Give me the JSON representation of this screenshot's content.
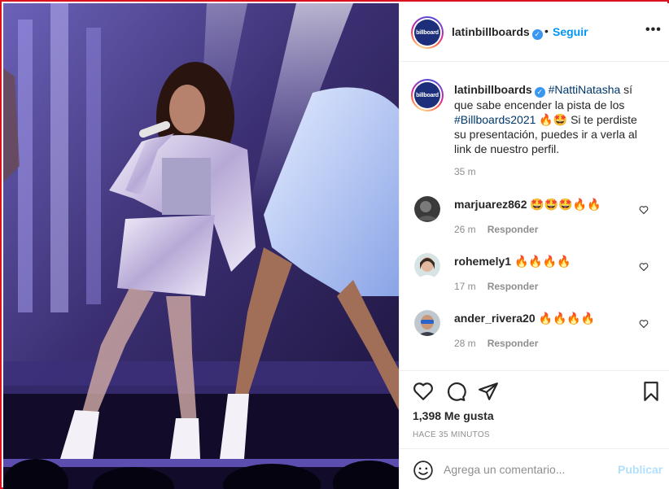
{
  "header": {
    "username": "latinbillboards",
    "separator": "•",
    "follow_label": "Seguir",
    "more_label": "•••",
    "logo_text": "billboard"
  },
  "caption": {
    "username": "latinbillboards",
    "hashtag1": "#NattiNatasha",
    "text1": " sí que sabe encender la pista de los ",
    "hashtag2": "#Billboards2021",
    "emojis": " 🔥🤩 ",
    "text2": "Si te perdiste su presentación, puedes ir a verla al link de nuestro perfil.",
    "time": "35 m"
  },
  "comments": [
    {
      "username": "marjuarez862",
      "text": "🤩🤩🤩🔥🔥",
      "time": "26 m",
      "reply": "Responder"
    },
    {
      "username": "rohemely1",
      "text": "🔥🔥🔥🔥",
      "time": "17 m",
      "reply": "Responder"
    },
    {
      "username": "ander_rivera20",
      "text": "🔥🔥🔥🔥",
      "time": "28 m",
      "reply": "Responder"
    }
  ],
  "actions": {
    "likes": "1,398 Me gusta",
    "ago": "HACE 35 MINUTOS"
  },
  "add_comment": {
    "placeholder": "Agrega un comentario...",
    "publish_label": "Publicar"
  },
  "colors": {
    "accent": "#0095f6",
    "publish_disabled": "#b2dffc",
    "frame": "#d9121f",
    "hashtag": "#00376b"
  }
}
